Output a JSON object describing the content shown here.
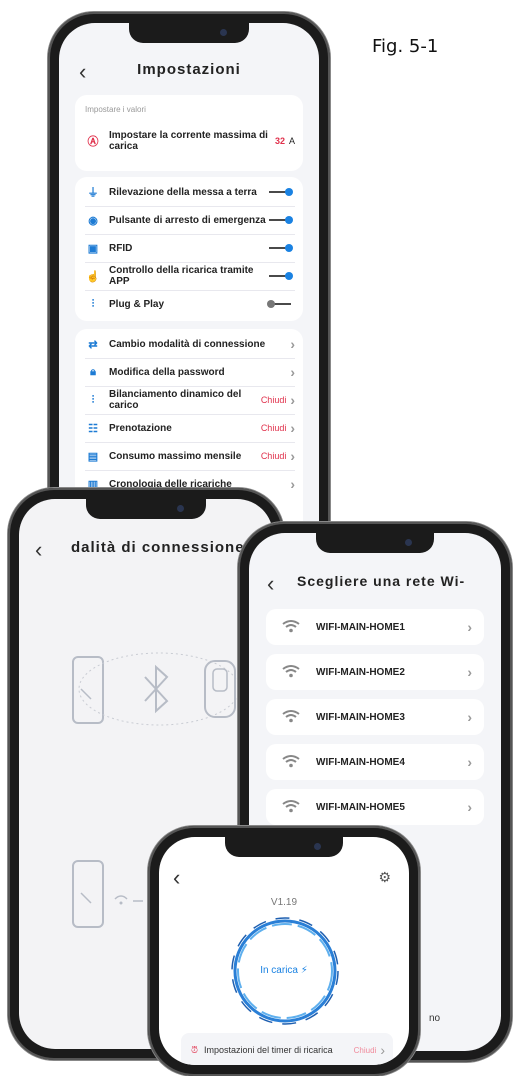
{
  "figure_label": "Fig. 5-1",
  "settings": {
    "title": "Impostazioni",
    "section_label": "Impostare i valori",
    "max_current": {
      "label": "Impostare la corrente massima di carica",
      "value": "32",
      "unit": "A"
    },
    "toggles": [
      {
        "label": "Rilevazione della messa a terra",
        "on": true
      },
      {
        "label": "Pulsante di arresto di emergenza",
        "on": true
      },
      {
        "label": "RFID",
        "on": true
      },
      {
        "label": "Controllo della ricarica tramite APP",
        "on": true
      },
      {
        "label": "Plug & Play",
        "on": false
      }
    ],
    "menu": [
      {
        "label": "Cambio modalità di connessione",
        "status": ""
      },
      {
        "label": "Modifica della password",
        "status": ""
      },
      {
        "label": "Bilanciamento dinamico del carico",
        "status": "Chiudi"
      },
      {
        "label": "Prenotazione",
        "status": "Chiudi"
      },
      {
        "label": "Consumo massimo mensile",
        "status": "Chiudi"
      },
      {
        "label": "Cronologia delle ricariche",
        "status": ""
      }
    ]
  },
  "connection": {
    "title": "dalità di connessione"
  },
  "wifi": {
    "title": "Scegliere una rete Wi-",
    "networks": [
      "WIFI-MAIN-HOME1",
      "WIFI-MAIN-HOME2",
      "WIFI-MAIN-HOME3",
      "WIFI-MAIN-HOME4",
      "WIFI-MAIN-HOME5"
    ],
    "partial_text": "no"
  },
  "charging": {
    "version": "V1.19",
    "status": "In carica",
    "timer_label": "Impostazioni del timer di ricarica",
    "timer_status": "Chiudi"
  },
  "colors": {
    "accent": "#1a82e2",
    "red": "#e0304b",
    "ring": "#2a7fd6"
  }
}
